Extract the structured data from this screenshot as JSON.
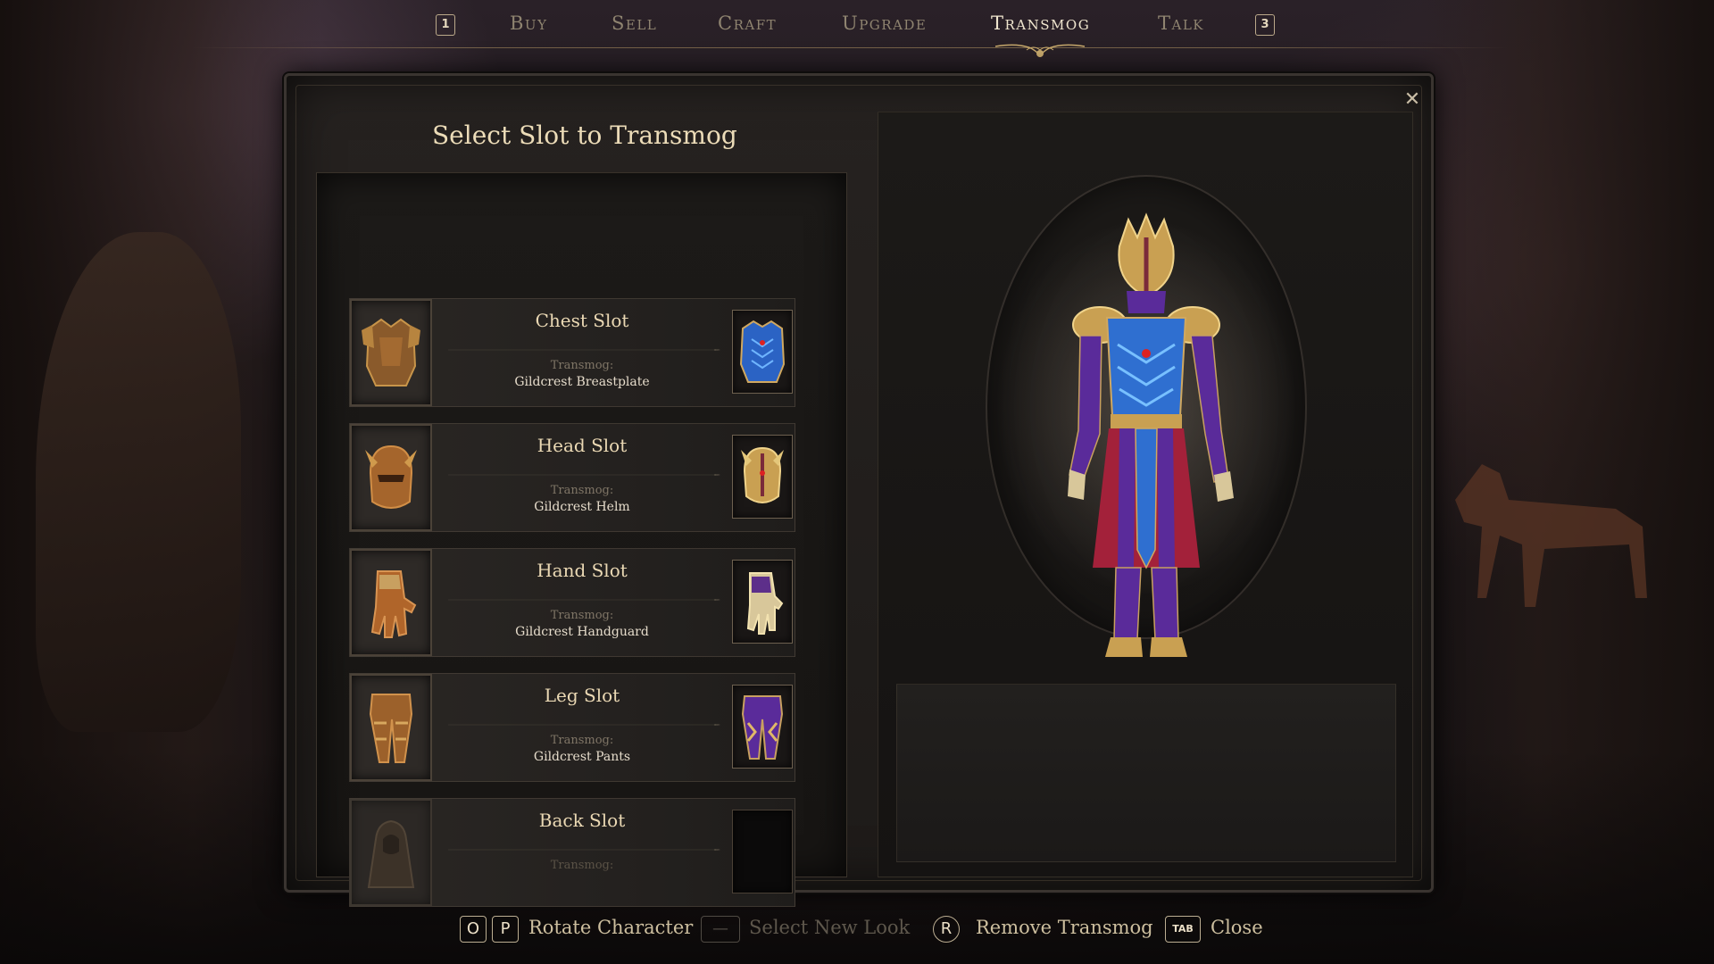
{
  "nav": {
    "left_key": "1",
    "right_key": "3",
    "tabs": [
      {
        "label": "Buy",
        "active": false
      },
      {
        "label": "Sell",
        "active": false
      },
      {
        "label": "Craft",
        "active": false
      },
      {
        "label": "Upgrade",
        "active": false
      },
      {
        "label": "Transmog",
        "active": true
      },
      {
        "label": "Talk",
        "active": false
      }
    ]
  },
  "panel": {
    "title": "Select Slot to Transmog",
    "close_icon": "close-icon"
  },
  "slots": [
    {
      "name": "Chest Slot",
      "sub_label": "Transmog:",
      "value": "Gildcrest Breastplate",
      "icon": "chest-armor-icon",
      "empty": false
    },
    {
      "name": "Head Slot",
      "sub_label": "Transmog:",
      "value": "Gildcrest Helm",
      "icon": "helmet-icon",
      "empty": false
    },
    {
      "name": "Hand Slot",
      "sub_label": "Transmog:",
      "value": "Gildcrest Handguard",
      "icon": "gauntlet-icon",
      "empty": false
    },
    {
      "name": "Leg Slot",
      "sub_label": "Transmog:",
      "value": "Gildcrest Pants",
      "icon": "leg-armor-icon",
      "empty": false
    },
    {
      "name": "Back Slot",
      "sub_label": "Transmog:",
      "value": "",
      "icon": "cloak-icon",
      "empty": true
    }
  ],
  "hints": {
    "rotate_key_1": "O",
    "rotate_key_2": "P",
    "rotate_label": "Rotate Character",
    "select_label": "Select New Look",
    "remove_key": "R",
    "remove_label": "Remove Transmog",
    "close_key": "TAB",
    "close_label": "Close"
  },
  "colors": {
    "accent_gold": "#ebd9b4",
    "tab_inactive": "#8f8470",
    "panel_bg": "#1e1b19",
    "armor_blue": "#2f6fd0",
    "armor_purple": "#5a2b9a",
    "armor_red": "#a3213a"
  }
}
